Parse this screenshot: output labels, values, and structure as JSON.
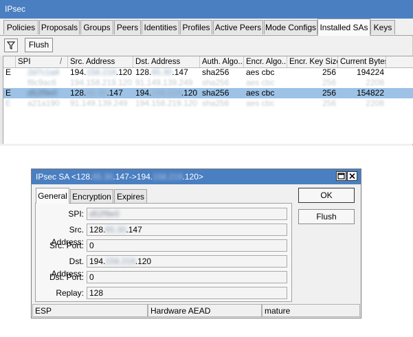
{
  "window": {
    "title": "IPsec"
  },
  "tabs": [
    "Policies",
    "Proposals",
    "Groups",
    "Peers",
    "Identities",
    "Profiles",
    "Active Peers",
    "Mode Configs",
    "Installed SAs",
    "Keys"
  ],
  "active_tab": "Installed SAs",
  "toolbar": {
    "filter_icon": "filter-icon",
    "flush_label": "Flush"
  },
  "table": {
    "columns": [
      "SPI",
      "Src. Address",
      "Dst. Address",
      "Auth. Algo...",
      "Encr. Algo...",
      "Encr. Key Size",
      "Current Bytes"
    ],
    "sort_indicator": "/",
    "rows": [
      {
        "flag": "E",
        "spi": "2d7c1a4",
        "src_pre": "194.",
        "src_mid": "158.219",
        "src_post": ".120",
        "dst_pre": "128.",
        "dst_mid": "65.30",
        "dst_post": ".147",
        "auth": "sha256",
        "encr": "aes cbc",
        "key_size": "256",
        "bytes": "194224",
        "selected": false,
        "blurred": false
      },
      {
        "flag": "",
        "spi": "f8c9ac6",
        "src": "194.158.219.120",
        "dst": "91.149.139.249",
        "auth": "sha256",
        "encr": "aes cbc",
        "key_size": "256",
        "bytes": "2208",
        "selected": false,
        "blurred": true
      },
      {
        "flag": "E",
        "spi": "d52f9e0",
        "src_pre": "128.",
        "src_mid": "65.30",
        "src_post": ".147",
        "dst_pre": "194.",
        "dst_mid": "158.219",
        "dst_post": ".120",
        "auth": "sha256",
        "encr": "aes cbc",
        "key_size": "256",
        "bytes": "154822",
        "selected": true,
        "blurred": false
      },
      {
        "flag": "E",
        "spi": "a21a190",
        "src": "91.149.139.249",
        "dst": "194.158.219.120",
        "auth": "sha256",
        "encr": "aes cbc",
        "key_size": "256",
        "bytes": "2208",
        "selected": false,
        "blurred": true
      }
    ]
  },
  "dialog": {
    "title_pre": "IPsec SA <128.",
    "title_mid1": "65.30",
    "title_mid2": ".147->194.",
    "title_mid3": "158.219",
    "title_post": ".120>",
    "restore_icon": "restore-icon",
    "close_icon": "close-icon",
    "tabs": [
      "General",
      "Encryption",
      "Expires"
    ],
    "active_tab": "General",
    "fields": {
      "spi": {
        "label": "SPI:",
        "value": "d52f9e0"
      },
      "src_address": {
        "label": "Src. Address:",
        "pre": "128.",
        "mid": "65.30",
        "post": ".147"
      },
      "src_port": {
        "label": "Src. Port:",
        "value": "0"
      },
      "dst_address": {
        "label": "Dst. Address:",
        "pre": "194.",
        "mid": "158.219",
        "post": ".120"
      },
      "dst_port": {
        "label": "Dst. Port:",
        "value": "0"
      },
      "replay": {
        "label": "Replay:",
        "value": "128"
      }
    },
    "ok_label": "OK",
    "flush_label": "Flush",
    "status": [
      "ESP",
      "Hardware AEAD",
      "mature"
    ]
  },
  "colors": {
    "titlebar": "#4a7fc1",
    "selected_row": "#9dc2e6"
  }
}
